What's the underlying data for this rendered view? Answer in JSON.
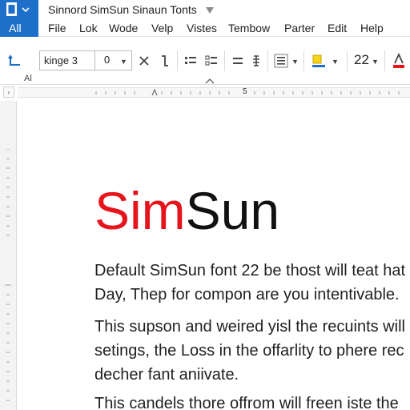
{
  "app": {
    "tile_label": "All",
    "title": "Sinnord SimSun Sinaun Tonts"
  },
  "menu": [
    "File",
    "Lok",
    "Wode",
    "Velp",
    "Vistes",
    "Tembow",
    "Parter",
    "Edit",
    "Help"
  ],
  "toolbar": {
    "font_name": "kinge  3",
    "font_size": "0",
    "size_value": "22",
    "section_label": "Al"
  },
  "ruler": {
    "marker": "5"
  },
  "document": {
    "heading_red": "Sim",
    "heading_black": "Sun",
    "paragraphs": [
      [
        "Default SimSun font 22 be thost will teat hat",
        "Day, Thep for compon are you intentivable."
      ],
      [
        "This supson and weired yisl the recuints will",
        "setings, the Loss in the offarlity to phere rec",
        "decher fant aniivate."
      ],
      [
        "This candels thore offrom will freen iste the"
      ]
    ]
  },
  "colors": {
    "accent": "#1e6fc9",
    "heading_red": "#e8141c",
    "font_color_bar": "#e8141c",
    "highlight_yellow": "#f7d21b"
  }
}
